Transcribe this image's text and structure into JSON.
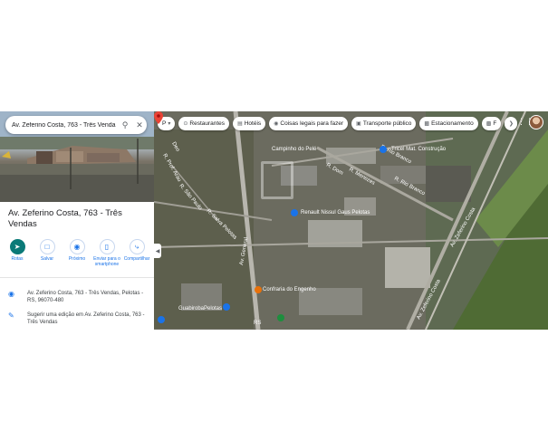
{
  "search": {
    "value": "Av. Zeferino Costa, 763 - Três Venda",
    "search_icon": "search-icon",
    "close_icon": "close-icon"
  },
  "place": {
    "title": "Av. Zeferino Costa, 763 - Três Vendas"
  },
  "actions": [
    {
      "label": "Rotas",
      "icon": "directions-icon"
    },
    {
      "label": "Salvar",
      "icon": "bookmark-icon"
    },
    {
      "label": "Próximo",
      "icon": "nearby-icon"
    },
    {
      "label": "Enviar para o smartphone",
      "icon": "phone-icon"
    },
    {
      "label": "Compartilhar",
      "icon": "share-icon"
    }
  ],
  "info": {
    "address": "Av. Zeferino Costa, 763 - Três Vendas, Pelotas - RS, 96070-480",
    "suggest_edit": "Sugerir uma edição em Av. Zeferino Costa, 763 - Três Vendas"
  },
  "map": {
    "chips": [
      {
        "label": "Restaurantes",
        "icon": "fork-knife-icon"
      },
      {
        "label": "Hotéis",
        "icon": "bed-icon"
      },
      {
        "label": "Coisas legais para fazer",
        "icon": "camera-icon"
      },
      {
        "label": "Transporte público",
        "icon": "transit-icon"
      },
      {
        "label": "Estacionamento",
        "icon": "parking-icon"
      },
      {
        "label": "F",
        "icon": "pharmacy-icon"
      }
    ],
    "menu_label": "P",
    "labels": {
      "campinho": "Campinho do Pelé",
      "rio_branco_1": "R. Rio Branco",
      "rio_branco_2": "R. Rio Branco",
      "zeferino_1": "Av. Zeferino Costa",
      "zeferino_2": "Av. Zeferino Costa",
      "tricel": "Tricel Mat. Construção",
      "renault": "Renault Nissul Gaus Pelotas",
      "conf": "Confraria do Engenho",
      "guabiroba": "Guabiroba",
      "pelotas": "Pelotas",
      "salva": "R. Salva Pelotas",
      "sao_paulo": "R. São Paulo",
      "prof": "R. Prof. Arau",
      "dom": "R. Dom",
      "deo": "Deo",
      "general": "Av. General",
      "menezes": "R. Menezes",
      "rs": "RS"
    }
  },
  "colors": {
    "accent": "#1a73e8",
    "primary_action": "#0b7a78",
    "pin": "#ea4335"
  }
}
